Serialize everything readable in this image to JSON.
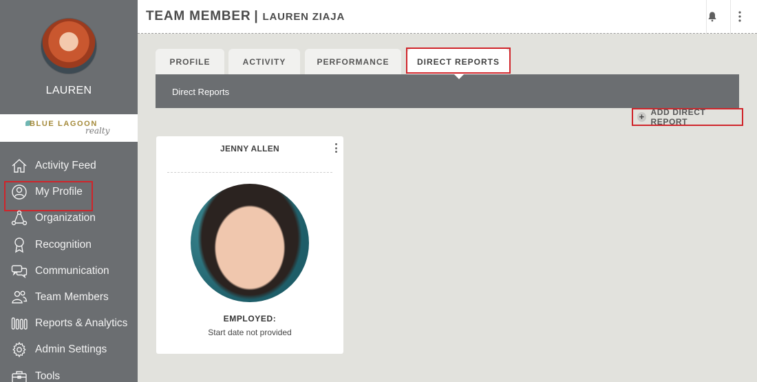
{
  "sidebar": {
    "user_name": "LAUREN",
    "logo": {
      "main": "BLUE LAGOON",
      "sub": "realty"
    },
    "items": [
      {
        "label": "Activity Feed",
        "icon": "home-icon"
      },
      {
        "label": "My Profile",
        "icon": "user-circle-icon"
      },
      {
        "label": "Organization",
        "icon": "org-network-icon"
      },
      {
        "label": "Recognition",
        "icon": "ribbon-award-icon"
      },
      {
        "label": "Communication",
        "icon": "chat-bubbles-icon"
      },
      {
        "label": "Team Members",
        "icon": "team-users-icon"
      },
      {
        "label": "Reports & Analytics",
        "icon": "bars-chart-icon"
      },
      {
        "label": "Admin Settings",
        "icon": "gear-icon"
      },
      {
        "label": "Tools",
        "icon": "toolbox-icon"
      }
    ]
  },
  "header": {
    "title": "TEAM MEMBER",
    "separator": "|",
    "member_name": "LAUREN ZIAJA"
  },
  "tabs": [
    {
      "label": "PROFILE",
      "active": false
    },
    {
      "label": "ACTIVITY",
      "active": false
    },
    {
      "label": "PERFORMANCE",
      "active": false
    },
    {
      "label": "DIRECT REPORTS",
      "active": true
    }
  ],
  "banner": {
    "title": "Direct Reports"
  },
  "actions": {
    "add_direct_report": "ADD DIRECT REPORT",
    "add_symbol": "+"
  },
  "report_card": {
    "name": "JENNY ALLEN",
    "status": "EMPLOYED:",
    "start_date": "Start date not provided"
  },
  "colors": {
    "sidebar_bg": "#6b6e71",
    "page_bg": "#e2e2dd",
    "highlight": "#d0242a",
    "logo_gold": "#a48a3a"
  }
}
